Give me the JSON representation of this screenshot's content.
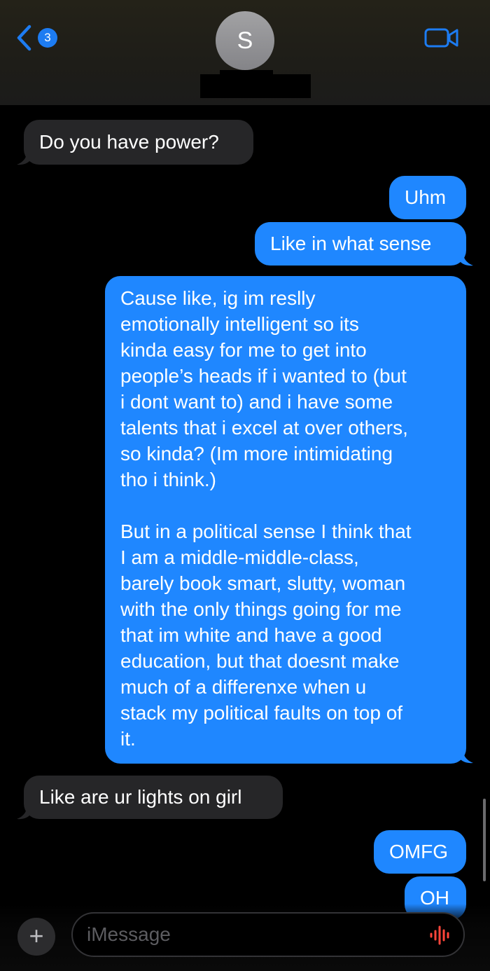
{
  "header": {
    "back_badge_count": "3",
    "avatar_initial": "S"
  },
  "messages": [
    {
      "direction": "in",
      "text": "Do you have power?"
    },
    {
      "direction": "out",
      "text": "Uhm"
    },
    {
      "direction": "out",
      "text": "Like in what sense"
    },
    {
      "direction": "out",
      "text": "Cause like, ig im reslly\nemotionally intelligent so its\nkinda easy for me to get into\npeople’s heads if i wanted to (but\ni dont want to) and i have some\ntalents that i excel at over others,\nso kinda? (Im more intimidating\ntho i think.)\n\nBut in a political sense I think that\nI am a middle-middle-class,\nbarely book smart, slutty, woman\nwith the only things going for me\nthat im white and have a good\neducation, but that doesnt make\nmuch of a differenxe when u\nstack my political faults on top of\nit."
    },
    {
      "direction": "in",
      "text": "Like are ur lights on girl"
    },
    {
      "direction": "out",
      "text": "OMFG"
    },
    {
      "direction": "out",
      "text": "OH"
    }
  ],
  "composer": {
    "placeholder": "iMessage"
  },
  "colors": {
    "incoming_bubble": "#262628",
    "outgoing_bubble": "#1f87ff",
    "accent": "#1d7cf2",
    "audio_icon": "#ff453a"
  },
  "icons": {
    "back": "chevron-left-icon",
    "video": "video-camera-icon",
    "add": "plus-icon",
    "audio": "waveform-icon"
  }
}
